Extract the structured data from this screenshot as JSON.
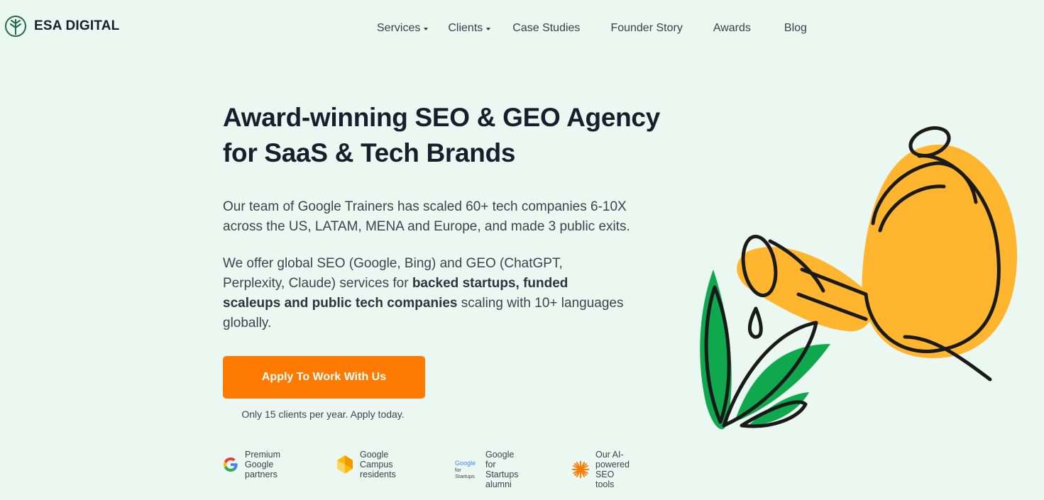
{
  "brand": {
    "name": "ESA DIGITAL"
  },
  "nav": {
    "items": [
      {
        "label": "Services",
        "dropdown": true
      },
      {
        "label": "Clients",
        "dropdown": true
      },
      {
        "label": "Case Studies",
        "dropdown": false
      },
      {
        "label": "Founder Story",
        "dropdown": false
      },
      {
        "label": "Awards",
        "dropdown": false
      },
      {
        "label": "Blog",
        "dropdown": false
      }
    ]
  },
  "hero": {
    "headline_line1": "Award-winning SEO & GEO Agency",
    "headline_line2": "for SaaS & Tech Brands",
    "paragraph1": "Our team of Google Trainers has scaled 60+ tech companies 6-10X across the US, LATAM, MENA and Europe, and made 3 public exits.",
    "paragraph2_start": "We offer global SEO (Google, Bing) and GEO (ChatGPT, Perplexity, Claude) services for ",
    "paragraph2_bold": "backed startups, funded scaleups and public tech companies",
    "paragraph2_end": " scaling with 10+ languages globally."
  },
  "cta": {
    "label": "Apply To Work With Us",
    "note": "Only 15 clients per year. Apply today."
  },
  "badges": [
    {
      "icon": "google-g-icon",
      "text": "Premium Google\npartners"
    },
    {
      "icon": "google-campus-icon",
      "text": "Google Campus\nresidents"
    },
    {
      "icon": "google-for-startups-icon",
      "icon_text_top": "Google",
      "icon_text_mid": "for",
      "icon_text_bottom": "Startups",
      "text": "Google for\nStartups alumni"
    },
    {
      "icon": "ai-sunburst-icon",
      "text": "Our AI-powered\nSEO tools"
    }
  ],
  "colors": {
    "background": "#ebf7f1",
    "brand_green": "#1f6b4a",
    "cta_orange": "#ff7a00",
    "illustration_yellow": "#ffb52e",
    "illustration_green": "#0fa84d"
  },
  "illustration": {
    "name": "watering-can-and-plant-illustration"
  }
}
